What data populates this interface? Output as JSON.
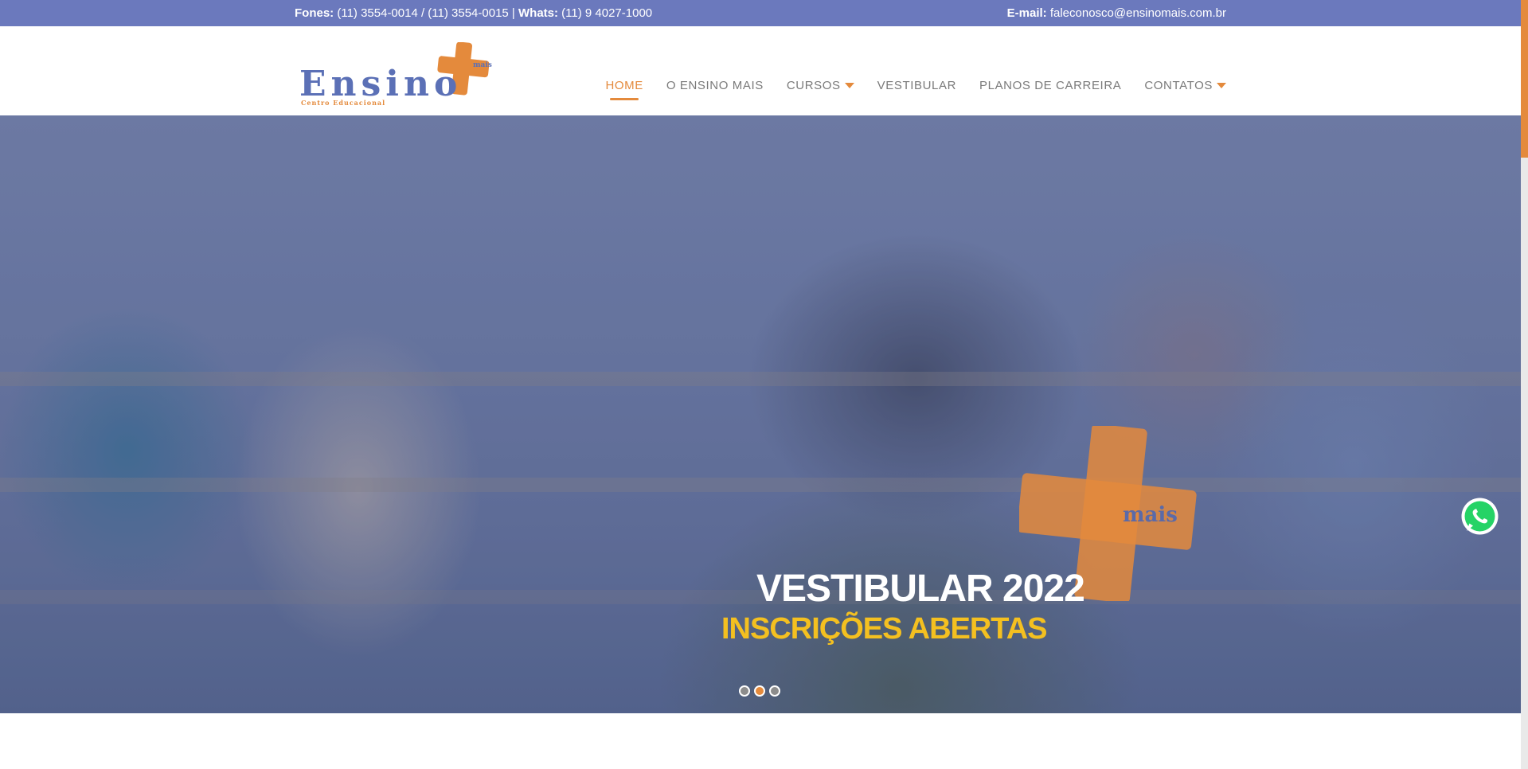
{
  "topbar": {
    "phones_label": "Fones:",
    "phones_value": " (11) 3554-0014 / (11) 3554-0015 | ",
    "whats_label": "Whats:",
    "whats_value": " (11) 9 4027-1000",
    "email_label": "E-mail:",
    "email_value": " faleconosco@ensinomais.com.br"
  },
  "logo": {
    "word": "Ensino",
    "badge": "mais",
    "tagline": "Centro Educacional"
  },
  "nav": {
    "items": [
      {
        "label": "HOME",
        "active": true,
        "dropdown": false
      },
      {
        "label": "O ENSINO MAIS",
        "active": false,
        "dropdown": false
      },
      {
        "label": "CURSOS",
        "active": false,
        "dropdown": true
      },
      {
        "label": "VESTIBULAR",
        "active": false,
        "dropdown": false
      },
      {
        "label": "PLANOS DE CARREIRA",
        "active": false,
        "dropdown": false
      },
      {
        "label": "CONTATOS",
        "active": false,
        "dropdown": true
      }
    ]
  },
  "hero": {
    "title": "VESTIBULAR 2022",
    "subtitle": "INSCRIÇÕES ABERTAS",
    "watermark": "mais",
    "slides": 3,
    "active_slide": 2
  },
  "colors": {
    "topbar": "#6b79bd",
    "accent": "#e48a3c",
    "nav_text": "#7a7a7a",
    "hero_subtitle": "#f4c020",
    "whatsapp": "#25d366",
    "logo_blue": "#5b70b6"
  },
  "icons": {
    "whatsapp": "whatsapp-icon",
    "dropdown": "chevron-down-icon"
  }
}
